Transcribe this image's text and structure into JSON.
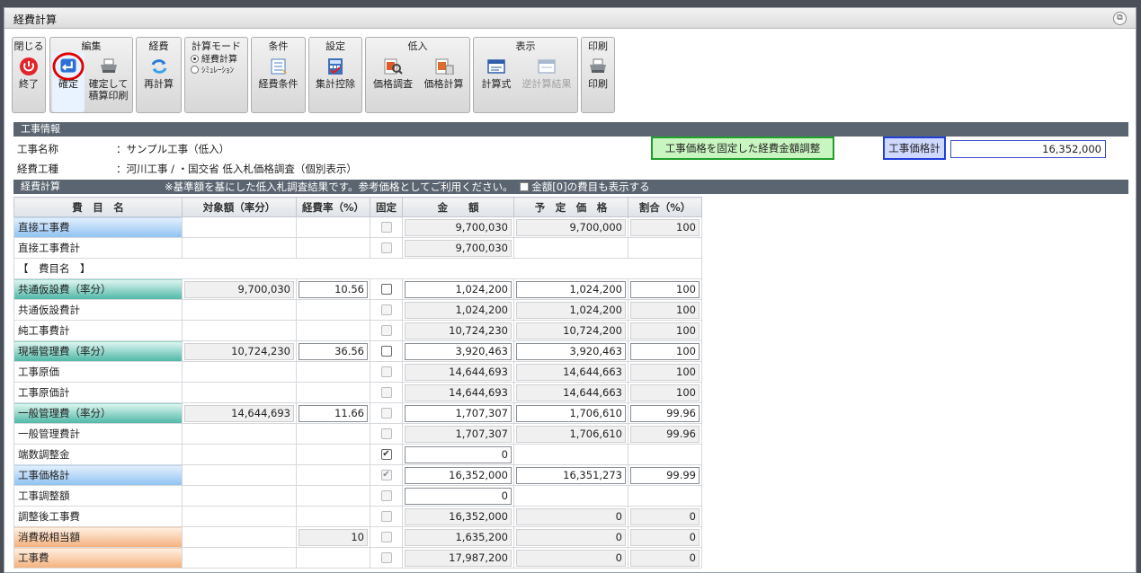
{
  "window": {
    "title": "経費計算"
  },
  "toolbar": {
    "close": {
      "group": "閉じる",
      "btn": "終了"
    },
    "edit": {
      "group": "編集",
      "confirm": "確定",
      "confirm_print1": "確定して",
      "confirm_print2": "積算印刷"
    },
    "cost": {
      "group": "経費",
      "recalc": "再計算"
    },
    "mode": {
      "group": "計算モード",
      "opt1": "経費計算",
      "opt2": "ｼﾐｭﾚｰｼｮﾝ"
    },
    "cond": {
      "group": "条件",
      "btn": "経費条件"
    },
    "settings": {
      "group": "設定",
      "btn": "集計控除"
    },
    "low": {
      "group": "低入",
      "btn1": "価格調査",
      "btn2": "価格計算"
    },
    "display": {
      "group": "表示",
      "btn1": "計算式",
      "btn2": "逆計算結果"
    },
    "print": {
      "group": "印刷",
      "btn": "印刷"
    }
  },
  "project": {
    "section": "工事情報",
    "name_label": "工事名称",
    "name_value": "：サンプル工事（低入）",
    "type_label": "経費工種",
    "type_value": "：河川工事 / ・国交省 低入札価格調査（個別表示）",
    "fixed_button": "工事価格を固定した経費金額調整",
    "total_label": "工事価格計",
    "total_value": "16,352,000"
  },
  "calc": {
    "section": "経費計算",
    "note": "※基準額を基にした低入札調査結果です。参考価格としてご利用ください。",
    "show_zero": "金額[0]の費目も表示する",
    "headers": [
      "費　目　名",
      "対象額（率分）",
      "経費率（%）",
      "固定",
      "金　　額",
      "予　定　価　格",
      "割合（%）"
    ],
    "rows": [
      {
        "name": "直接工事費",
        "style": "blue",
        "target": "",
        "rate": "",
        "fixed": "off",
        "amount": "9,700,030",
        "planned": "9,700,000",
        "ratio": "100",
        "amt_ed": false,
        "ratio_ed": false
      },
      {
        "name": "直接工事費計",
        "style": "",
        "target": "",
        "rate": "",
        "fixed": "off",
        "amount": "9,700,030",
        "planned": "",
        "ratio": "",
        "amt_ed": false,
        "ratio_ed": false
      },
      {
        "name": "【　費目名　】",
        "style": "",
        "target": "",
        "rate": "",
        "fixed": "none",
        "amount": "",
        "planned": "",
        "ratio": "",
        "amt_ed": false,
        "ratio_ed": false
      },
      {
        "name": "共通仮設費（率分）",
        "style": "teal",
        "target": "9,700,030",
        "rate": "10.56",
        "fixed": "en",
        "amount": "1,024,200",
        "planned": "1,024,200",
        "ratio": "100",
        "amt_ed": true,
        "ratio_ed": true
      },
      {
        "name": "共通仮設費計",
        "style": "",
        "target": "",
        "rate": "",
        "fixed": "off",
        "amount": "1,024,200",
        "planned": "1,024,200",
        "ratio": "100",
        "amt_ed": false,
        "ratio_ed": false
      },
      {
        "name": "純工事費計",
        "style": "",
        "target": "",
        "rate": "",
        "fixed": "off",
        "amount": "10,724,230",
        "planned": "10,724,200",
        "ratio": "100",
        "amt_ed": false,
        "ratio_ed": false
      },
      {
        "name": "現場管理費（率分）",
        "style": "teal",
        "target": "10,724,230",
        "rate": "36.56",
        "fixed": "en",
        "amount": "3,920,463",
        "planned": "3,920,463",
        "ratio": "100",
        "amt_ed": true,
        "ratio_ed": true
      },
      {
        "name": "工事原価",
        "style": "",
        "target": "",
        "rate": "",
        "fixed": "off",
        "amount": "14,644,693",
        "planned": "14,644,663",
        "ratio": "100",
        "amt_ed": false,
        "ratio_ed": false
      },
      {
        "name": "工事原価計",
        "style": "",
        "target": "",
        "rate": "",
        "fixed": "off",
        "amount": "14,644,693",
        "planned": "14,644,663",
        "ratio": "100",
        "amt_ed": false,
        "ratio_ed": false
      },
      {
        "name": "一般管理費（率分）",
        "style": "teal",
        "target": "14,644,693",
        "rate": "11.66",
        "fixed": "off",
        "amount": "1,707,307",
        "planned": "1,706,610",
        "ratio": "99.96",
        "amt_ed": true,
        "ratio_ed": true
      },
      {
        "name": "一般管理費計",
        "style": "",
        "target": "",
        "rate": "",
        "fixed": "off",
        "amount": "1,707,307",
        "planned": "1,706,610",
        "ratio": "99.96",
        "amt_ed": false,
        "ratio_ed": false
      },
      {
        "name": "端数調整金",
        "style": "",
        "target": "",
        "rate": "",
        "fixed": "chk",
        "amount": "0",
        "planned": "",
        "ratio": "",
        "amt_ed": true,
        "ratio_ed": false
      },
      {
        "name": "工事価格計",
        "style": "blue",
        "target": "",
        "rate": "",
        "fixed": "chkdis",
        "amount": "16,352,000",
        "planned": "16,351,273",
        "ratio": "99.99",
        "amt_ed": true,
        "ratio_ed": true
      },
      {
        "name": "工事調整額",
        "style": "",
        "target": "",
        "rate": "",
        "fixed": "off",
        "amount": "0",
        "planned": "",
        "ratio": "",
        "amt_ed": true,
        "ratio_ed": false
      },
      {
        "name": "調整後工事費",
        "style": "",
        "target": "",
        "rate": "",
        "fixed": "off",
        "amount": "16,352,000",
        "planned": "0",
        "ratio": "0",
        "amt_ed": false,
        "ratio_ed": false
      },
      {
        "name": "消費税相当額",
        "style": "orng",
        "target": "",
        "rate": "10",
        "fixed": "off",
        "amount": "1,635,200",
        "planned": "0",
        "ratio": "0",
        "amt_ed": false,
        "ratio_ed": false
      },
      {
        "name": "工事費",
        "style": "orng",
        "target": "",
        "rate": "",
        "fixed": "off",
        "amount": "17,987,200",
        "planned": "0",
        "ratio": "0",
        "amt_ed": false,
        "ratio_ed": false
      }
    ]
  }
}
